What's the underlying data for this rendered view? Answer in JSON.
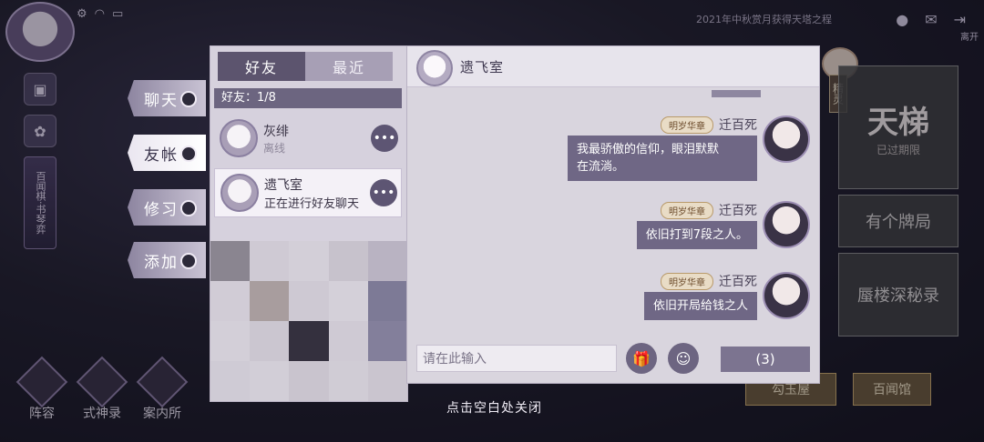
{
  "hud": {
    "top_banner": "2021年中秋赏月获得天塔之程",
    "exit_label": "离开",
    "left_scroll_text": "百闻棋·书琴弈"
  },
  "side_tabs": [
    {
      "label": "聊天",
      "active": false
    },
    {
      "label": "友帐",
      "active": true
    },
    {
      "label": "修习",
      "active": false
    },
    {
      "label": "添加",
      "active": false
    }
  ],
  "friend_panel": {
    "tabs": [
      {
        "label": "好友",
        "active": true
      },
      {
        "label": "最近",
        "active": false
      }
    ],
    "count_label": "好友：1/8",
    "friends": [
      {
        "name": "灰绯",
        "status": "离线",
        "more": "•••"
      },
      {
        "name": "遗飞室",
        "status": "正在进行好友聊天",
        "more": "•••"
      }
    ]
  },
  "chat": {
    "header_name": "遗飞室",
    "messages": [
      {
        "badge": "明岁华章",
        "sender": "迁百死",
        "text_lines": [
          "我最骄傲的信仰，眼泪默默",
          "在流淌。"
        ]
      },
      {
        "badge": "明岁华章",
        "sender": "迁百死",
        "text_lines": [
          "依旧打到7段之人。"
        ]
      },
      {
        "badge": "明岁华章",
        "sender": "迁百死",
        "text_lines": [
          "依旧开局给钱之人"
        ]
      }
    ],
    "input_placeholder": "请在此输入",
    "gift_icon": "🎁",
    "emoji_icon": "☺",
    "send_count": "(3)"
  },
  "right_panels": {
    "sprite_label": "精灵",
    "title_glyph": "天梯",
    "title_sub": "已过期限",
    "item2": "有个牌局",
    "item3": "蜃楼深秘录",
    "btn1": "勾玉屋",
    "btn2": "百闻馆"
  },
  "bottom_nav": [
    {
      "label": "阵容"
    },
    {
      "label": "式神录"
    },
    {
      "label": "案内所"
    }
  ],
  "close_hint": "点击空白处关闭",
  "colors": {
    "panel_bg": "#d9d5de",
    "bubble": "#6f6785",
    "tab_active": "#5c546e"
  }
}
